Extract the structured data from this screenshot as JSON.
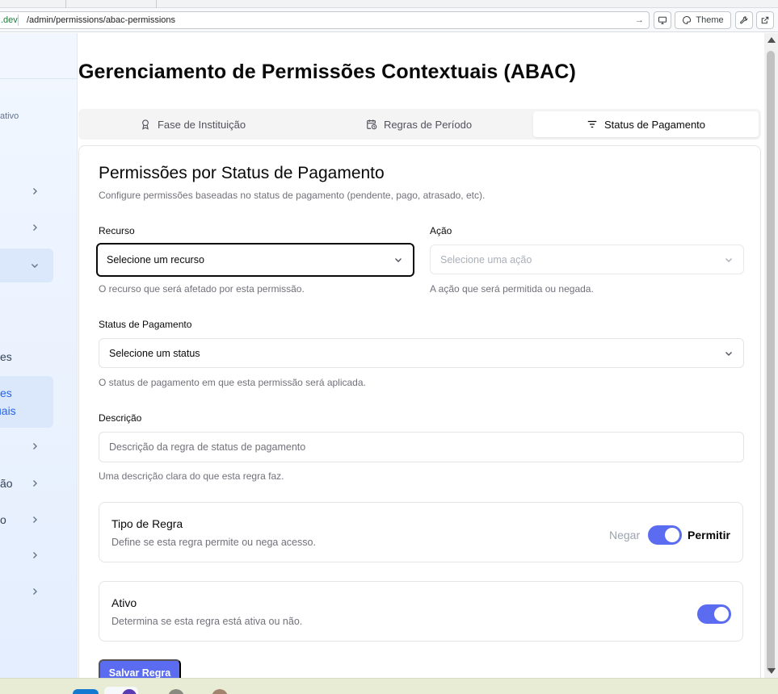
{
  "browser": {
    "domain": ".dev",
    "path": "/admin/permissions/abac-permissions",
    "theme_label": "Theme"
  },
  "sidebar": {
    "subtitle_fragment": "ativo",
    "items": [
      {
        "label": "",
        "has_chevron": true
      },
      {
        "label": "",
        "has_chevron": true
      },
      {
        "label": "",
        "has_chevron": true,
        "expanded": true
      },
      {
        "label": "es"
      },
      {
        "label": "es",
        "label2": "uais",
        "active": true
      },
      {
        "label": "",
        "has_chevron": true
      },
      {
        "label": "ão",
        "has_chevron": true
      },
      {
        "label": "o",
        "has_chevron": true
      },
      {
        "label": "",
        "has_chevron": true
      },
      {
        "label": "",
        "has_chevron": true
      }
    ]
  },
  "page": {
    "title": "Gerenciamento de Permissões Contextuais (ABAC)"
  },
  "tabs": [
    {
      "label": "Fase de Instituição",
      "icon": "ribbon-icon",
      "active": false
    },
    {
      "label": "Regras de Período",
      "icon": "calendar-clock-icon",
      "active": false
    },
    {
      "label": "Status de Pagamento",
      "icon": "filter-lines-icon",
      "active": true
    }
  ],
  "card": {
    "title": "Permissões por Status de Pagamento",
    "description": "Configure permissões baseadas no status de pagamento (pendente, pago, atrasado, etc).",
    "resource": {
      "label": "Recurso",
      "placeholder": "Selecione um recurso",
      "help": "O recurso que será afetado por esta permissão."
    },
    "action": {
      "label": "Ação",
      "placeholder": "Selecione uma ação",
      "help": "A ação que será permitida ou negada."
    },
    "status": {
      "label": "Status de Pagamento",
      "placeholder": "Selecione um status",
      "help": "O status de pagamento em que esta permissão será aplicada."
    },
    "description_field": {
      "label": "Descrição",
      "placeholder": "Descrição da regra de status de pagamento",
      "help": "Uma descrição clara do que esta regra faz."
    },
    "rule_type": {
      "title": "Tipo de Regra",
      "description": "Define se esta regra permite ou nega acesso.",
      "off_label": "Negar",
      "on_label": "Permitir",
      "value": true
    },
    "active": {
      "title": "Ativo",
      "description": "Determina se esta regra está ativa ou não.",
      "value": true
    },
    "save_label": "Salvar Regra"
  },
  "colors": {
    "accent": "#5b6cf0",
    "sidebar_bg": "#eaf2ff",
    "muted_text": "#71717a"
  }
}
